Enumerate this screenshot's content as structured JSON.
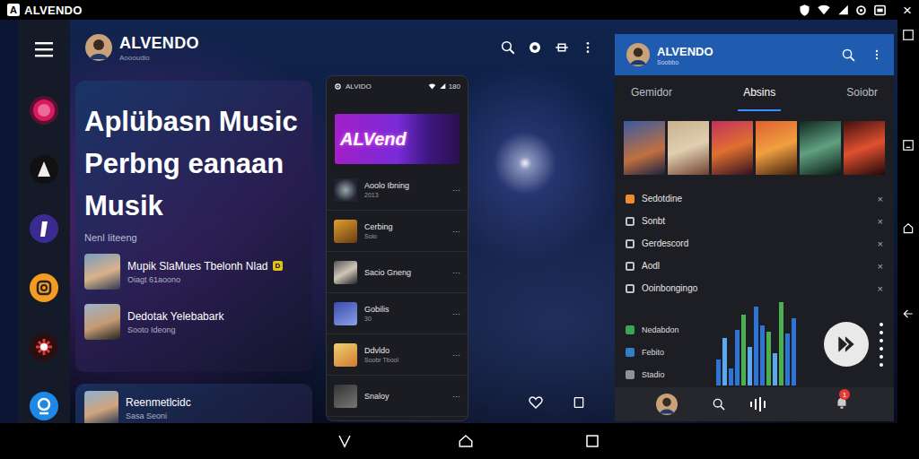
{
  "status_bar": {
    "logo": "A",
    "title": "ALVENDO",
    "close": "×"
  },
  "header": {
    "title": "ALVENDO",
    "subtitle": "Aoooudio"
  },
  "hero": {
    "title": "Aplübasn Music Perbng eanaan Musik",
    "subtitle": "Nenl Iiteeng",
    "items": [
      {
        "title": "Mupik SlaMues Tbelonh Nlad",
        "subtitle": "Oiagt 61aoono",
        "badge": "D"
      },
      {
        "title": "Dedotak Yelebabark",
        "subtitle": "Sooto Ideong"
      }
    ]
  },
  "card": {
    "title": "Reenmetlcidc",
    "subtitle": "Sasa Seoni"
  },
  "phone": {
    "title": "ALVIDO",
    "battery": "180",
    "banner": "ALVend",
    "more": "···",
    "items": [
      {
        "title": "Aoolo Ibning",
        "subtitle": "2013"
      },
      {
        "title": "Cerbing",
        "subtitle": "Soio"
      },
      {
        "title": "Sacio Gneng"
      },
      {
        "title": "Gobilis",
        "subtitle": "30"
      },
      {
        "title": "Ddvldo",
        "subtitle": "Soobr Tbool"
      },
      {
        "title": "Snaloy"
      }
    ]
  },
  "right_panel": {
    "title": "ALVENDO",
    "subtitle": "Soobbo",
    "tabs": [
      {
        "label": "Gemidor",
        "selected": false
      },
      {
        "label": "Absins",
        "selected": true
      },
      {
        "label": "Soiobr",
        "selected": false
      }
    ],
    "close": "×",
    "list": [
      {
        "label": "Sedotdine",
        "color": "#f08c2a"
      },
      {
        "label": "Sonbt",
        "color": "#bfc3c8"
      },
      {
        "label": "Gerdescord",
        "color": "#bfc3c8"
      },
      {
        "label": "Aodl",
        "color": "#bfc3c8"
      },
      {
        "label": "Ooinbongingo",
        "color": "#bfc3c8"
      }
    ],
    "menu": [
      {
        "label": "Nedabdon",
        "color": "#3aa655"
      },
      {
        "label": "Febito",
        "color": "#2f80c9"
      },
      {
        "label": "Stadio",
        "color": "#8d9298"
      }
    ],
    "equalizer": {
      "bars": [
        {
          "level": 0.3,
          "color": "#2d74d6"
        },
        {
          "level": 0.55,
          "color": "#5aa8ee"
        },
        {
          "level": 0.2,
          "color": "#2d74d6"
        },
        {
          "level": 0.65,
          "color": "#2d74d6"
        },
        {
          "level": 0.82,
          "color": "#4caf50"
        },
        {
          "level": 0.45,
          "color": "#5aa8ee"
        },
        {
          "level": 0.92,
          "color": "#2d74d6"
        },
        {
          "level": 0.7,
          "color": "#2d74d6"
        },
        {
          "level": 0.62,
          "color": "#4caf50"
        },
        {
          "level": 0.38,
          "color": "#5aa8ee"
        },
        {
          "level": 0.97,
          "color": "#4caf50"
        },
        {
          "level": 0.6,
          "color": "#2d74d6"
        },
        {
          "level": 0.78,
          "color": "#2d74d6"
        }
      ]
    },
    "notification": "1"
  }
}
